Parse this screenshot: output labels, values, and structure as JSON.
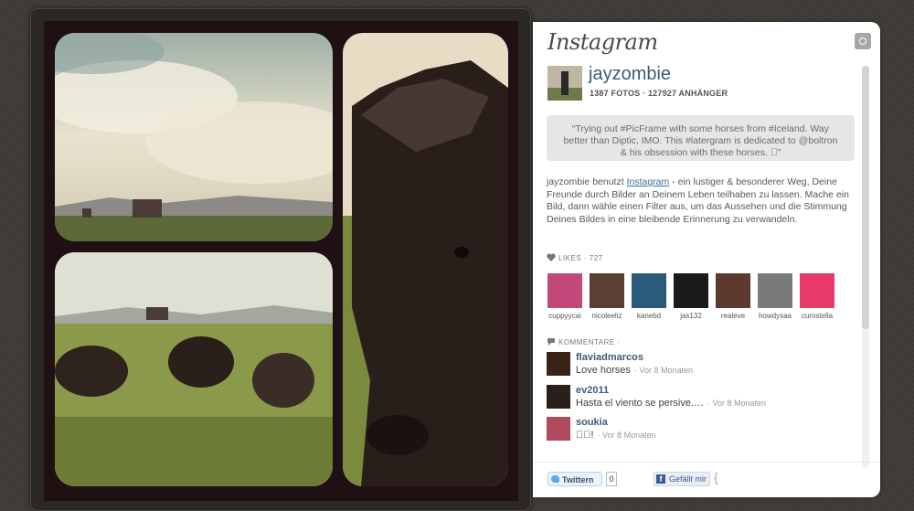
{
  "brand": "Instagram",
  "user": {
    "username": "jayzombie",
    "stats": "1387 FOTOS · 127927 ANHÄNGER"
  },
  "caption": "“Trying out #PicFrame with some horses from #Iceland. Way better than Diptic, IMO. This #latergram is dedicated to @boltron & his obsession with these horses. ￿”",
  "description": {
    "before": "jayzombie benutzt ",
    "link": "Instagram",
    "after": " - ein lustiger & besonderer Weg, Deine Freunde durch Bilder an Deinem Leben teilhaben zu lassen. Mache ein Bild, dann wähle einen Filter aus, um das Aussehen und die Stimmung Deines Bildes in eine bleibende Erinnerung zu verwandeln."
  },
  "likes": {
    "label": "LIKES",
    "count": "· 727",
    "users": [
      {
        "name": "cuppyycai",
        "color": "#c2487a"
      },
      {
        "name": "nicoleeliz",
        "color": "#5a3f35"
      },
      {
        "name": "kanebd",
        "color": "#2b5b7a"
      },
      {
        "name": "jas132",
        "color": "#1a1a1a"
      },
      {
        "name": "realeve",
        "color": "#5c3a2e"
      },
      {
        "name": "howdysaa",
        "color": "#7a7a7a"
      },
      {
        "name": "curostella",
        "color": "#e73a6a"
      }
    ]
  },
  "comments": {
    "label": "KOMMENTARE",
    "suffix": "·",
    "items": [
      {
        "user": "flaviadmarcos",
        "text": "Love horses",
        "time": "· Vor 8 Monaten",
        "color": "#3a2418"
      },
      {
        "user": "ev2011",
        "text": "Hasta el viento se persive.…",
        "time": "· Vor 8 Monaten",
        "color": "#2a1f1a"
      },
      {
        "user": "soukia",
        "text": "￿￿!",
        "time": "· Vor 8 Monaten",
        "color": "#b14a5c"
      }
    ]
  },
  "footer": {
    "tweet_label": "Twittern",
    "tweet_count": "0",
    "fb_label": "Gefällt mir",
    "fb_count": "{"
  },
  "colors": {
    "link": "#3f5a78",
    "caption_bg": "#e6e6e6",
    "frame": "#1f1014"
  }
}
